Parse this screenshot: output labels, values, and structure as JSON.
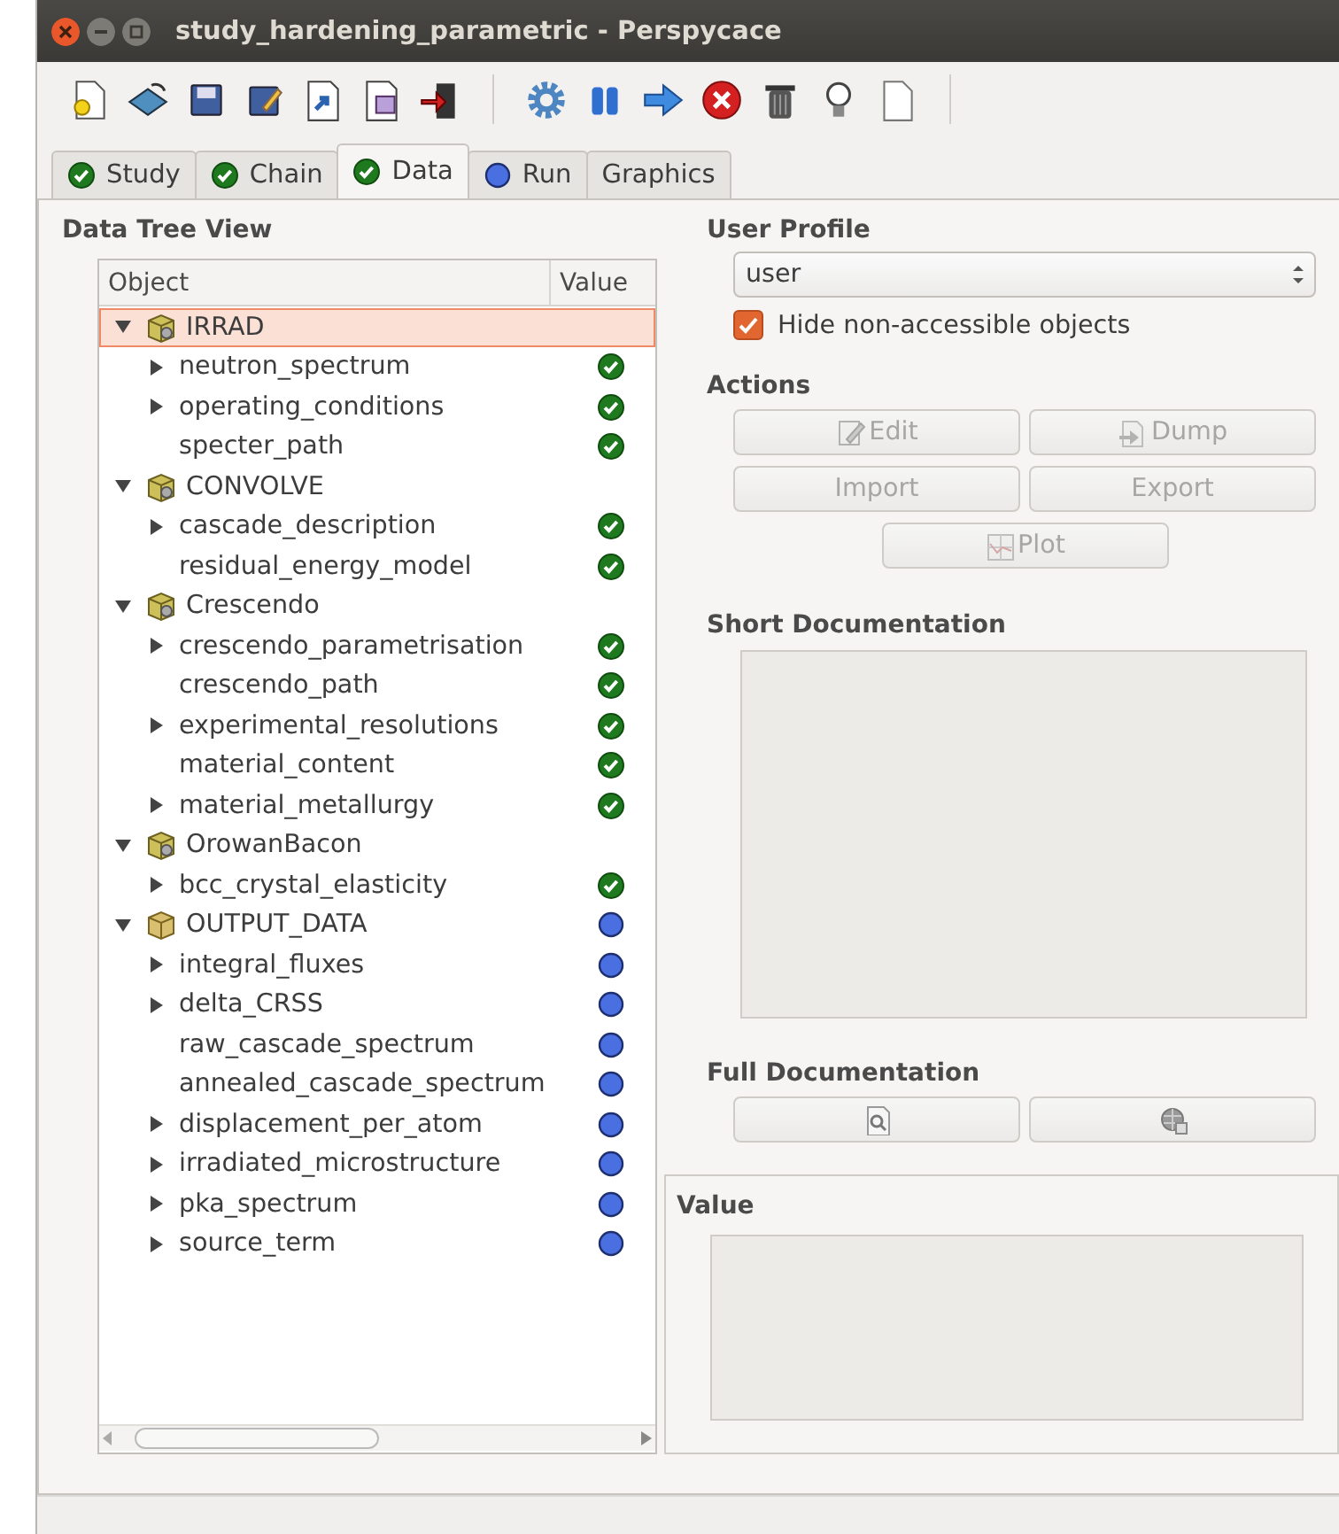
{
  "window": {
    "title": "study_hardening_parametric - Perspycace"
  },
  "tabs": [
    {
      "label": "Study",
      "complete": true,
      "selected": false
    },
    {
      "label": "Chain",
      "complete": true,
      "selected": false
    },
    {
      "label": "Data",
      "complete": true,
      "selected": true
    },
    {
      "label": "Run",
      "complete": false,
      "selected": false
    },
    {
      "label": "Graphics",
      "selected": false
    }
  ],
  "tree": {
    "title": "Data Tree View",
    "columns": [
      "Object",
      "Value"
    ],
    "items": [
      {
        "label": "IRRAD",
        "kind": "module",
        "expanded": true,
        "selected": true,
        "children": [
          {
            "label": "neutron_spectrum",
            "complete": true,
            "expanded": false,
            "selected": false
          },
          {
            "label": "operating_conditions",
            "complete": true,
            "expanded": false,
            "selected": false
          },
          {
            "label": "specter_path",
            "complete": true,
            "selected": false
          }
        ]
      },
      {
        "label": "CONVOLVE",
        "kind": "module",
        "expanded": true,
        "selected": false,
        "children": [
          {
            "label": "cascade_description",
            "complete": true,
            "expanded": false,
            "selected": false
          },
          {
            "label": "residual_energy_model",
            "complete": true,
            "selected": false
          }
        ]
      },
      {
        "label": "Crescendo",
        "kind": "module",
        "expanded": true,
        "selected": false,
        "children": [
          {
            "label": "crescendo_parametrisation",
            "complete": true,
            "expanded": false,
            "selected": false
          },
          {
            "label": "crescendo_path",
            "complete": true,
            "selected": false
          },
          {
            "label": "experimental_resolutions",
            "complete": true,
            "expanded": false,
            "selected": false
          },
          {
            "label": "material_content",
            "complete": true,
            "selected": false
          },
          {
            "label": "material_metallurgy",
            "complete": true,
            "expanded": false,
            "selected": false
          }
        ]
      },
      {
        "label": "OrowanBacon",
        "kind": "module",
        "expanded": true,
        "selected": false,
        "children": [
          {
            "label": "bcc_crystal_elasticity",
            "complete": true,
            "expanded": false,
            "selected": false
          }
        ]
      },
      {
        "label": "OUTPUT_DATA",
        "kind": "data",
        "complete": false,
        "expanded": true,
        "selected": false,
        "children": [
          {
            "label": "integral_fluxes",
            "complete": false,
            "expanded": false,
            "selected": false
          },
          {
            "label": "delta_CRSS",
            "complete": false,
            "expanded": false,
            "selected": false
          },
          {
            "label": "raw_cascade_spectrum",
            "complete": false,
            "selected": false
          },
          {
            "label": "annealed_cascade_spectrum",
            "complete": false,
            "selected": false
          },
          {
            "label": "displacement_per_atom",
            "complete": false,
            "expanded": false,
            "selected": false
          },
          {
            "label": "irradiated_microstructure",
            "complete": false,
            "expanded": false,
            "selected": false
          },
          {
            "label": "pka_spectrum",
            "complete": false,
            "expanded": false,
            "selected": false
          },
          {
            "label": "source_term",
            "complete": false,
            "expanded": false,
            "selected": false
          }
        ]
      }
    ]
  },
  "user_profile": {
    "title": "User Profile",
    "value": "user",
    "option": {
      "label": "Hide non-accessible objects",
      "checked": true
    }
  },
  "actions": {
    "title": "Actions",
    "buttons": [
      {
        "label": "Edit",
        "kind": "edit",
        "disabled": true
      },
      {
        "label": "Dump",
        "kind": "dump",
        "disabled": true
      },
      {
        "label": "Import",
        "kind": "import",
        "disabled": true
      },
      {
        "label": "Export",
        "kind": "export",
        "disabled": true
      },
      {
        "label": "Plot",
        "kind": "plot",
        "disabled": true
      }
    ]
  },
  "short_documentation": {
    "title": "Short Documentation"
  },
  "full_documentation": {
    "title": "Full Documentation",
    "buttons": [
      {
        "kind": "preview",
        "disabled": false
      },
      {
        "kind": "web",
        "disabled": false
      }
    ]
  },
  "value": {
    "title": "Value"
  }
}
